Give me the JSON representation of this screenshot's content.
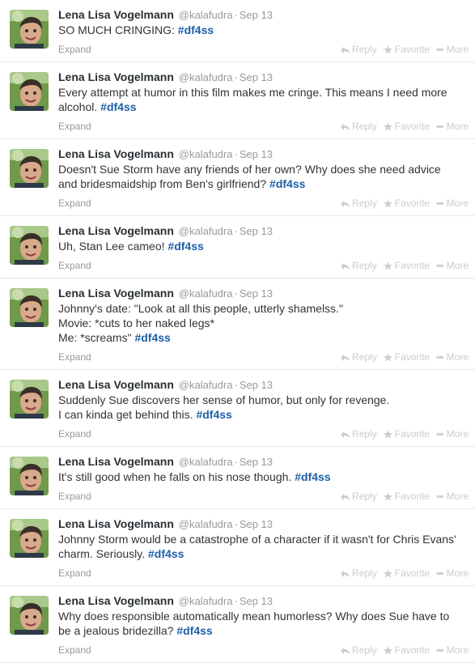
{
  "actions": {
    "reply": "Reply",
    "favorite": "Favorite",
    "more": "More",
    "expand": "Expand"
  },
  "tweets": [
    {
      "name": "Lena Lisa Vogelmann",
      "handle": "@kalafudra",
      "sep": "·",
      "date": "Sep 13",
      "lines": [
        {
          "text": "SO MUCH CRINGING: ",
          "tag": "#df4ss"
        }
      ]
    },
    {
      "name": "Lena Lisa Vogelmann",
      "handle": "@kalafudra",
      "sep": "·",
      "date": "Sep 13",
      "lines": [
        {
          "text": "Every attempt at humor in this film makes me cringe. This means I need more",
          "tag": ""
        },
        {
          "text": "alcohol. ",
          "tag": "#df4ss"
        }
      ]
    },
    {
      "name": "Lena Lisa Vogelmann",
      "handle": "@kalafudra",
      "sep": "·",
      "date": "Sep 13",
      "lines": [
        {
          "text": "Doesn't Sue Storm have any friends of her own? Why does she need advice",
          "tag": ""
        },
        {
          "text": "and bridesmaidship from Ben's girlfriend? ",
          "tag": "#df4ss"
        }
      ]
    },
    {
      "name": "Lena Lisa Vogelmann",
      "handle": "@kalafudra",
      "sep": "·",
      "date": "Sep 13",
      "lines": [
        {
          "text": "Uh, Stan Lee cameo! ",
          "tag": "#df4ss"
        }
      ]
    },
    {
      "name": "Lena Lisa Vogelmann",
      "handle": "@kalafudra",
      "sep": "·",
      "date": "Sep 13",
      "lines": [
        {
          "text": "Johnny's date: \"Look at all this people, utterly shamelss.\"",
          "tag": ""
        },
        {
          "text": "Movie: *cuts to her naked legs*",
          "tag": ""
        },
        {
          "text": "Me: *screams\" ",
          "tag": "#df4ss"
        }
      ]
    },
    {
      "name": "Lena Lisa Vogelmann",
      "handle": "@kalafudra",
      "sep": "·",
      "date": "Sep 13",
      "lines": [
        {
          "text": "Suddenly Sue discovers her sense of humor, but only for revenge.",
          "tag": ""
        },
        {
          "text": "I can kinda get behind this.  ",
          "tag": "#df4ss"
        }
      ]
    },
    {
      "name": "Lena Lisa Vogelmann",
      "handle": "@kalafudra",
      "sep": "·",
      "date": "Sep 13",
      "lines": [
        {
          "text": "It's still good when he falls on his nose though. ",
          "tag": "#df4ss"
        }
      ]
    },
    {
      "name": "Lena Lisa Vogelmann",
      "handle": "@kalafudra",
      "sep": "·",
      "date": "Sep 13",
      "lines": [
        {
          "text": "Johnny Storm would be a catastrophe of a character if it wasn't for Chris Evans'",
          "tag": ""
        },
        {
          "text": "charm. Seriously. ",
          "tag": "#df4ss"
        }
      ]
    },
    {
      "name": "Lena Lisa Vogelmann",
      "handle": "@kalafudra",
      "sep": "·",
      "date": "Sep 13",
      "lines": [
        {
          "text": "Why does responsible automatically mean humorless? Why does Sue have to",
          "tag": ""
        },
        {
          "text": "be a jealous bridezilla? ",
          "tag": "#df4ss"
        }
      ]
    }
  ]
}
